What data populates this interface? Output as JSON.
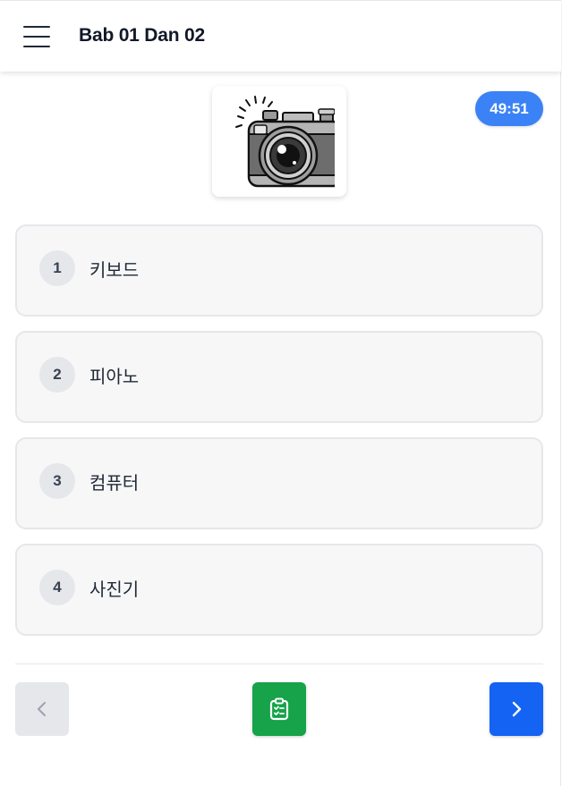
{
  "header": {
    "title": "Bab 01 Dan 02",
    "menu_icon": "hamburger-menu-icon"
  },
  "question": {
    "image": "camera-illustration",
    "timer": "49:51"
  },
  "options": [
    {
      "number": "1",
      "label": "키보드"
    },
    {
      "number": "2",
      "label": "피아노"
    },
    {
      "number": "3",
      "label": "컴퓨터"
    },
    {
      "number": "4",
      "label": "사진기"
    }
  ],
  "footer": {
    "prev_icon": "chevron-left-icon",
    "clipboard_icon": "clipboard-check-icon",
    "next_icon": "chevron-right-icon"
  },
  "colors": {
    "timer_bg": "#3b82f6",
    "clipboard_bg": "#16a34a",
    "next_bg": "#1463f3",
    "prev_bg": "#e5e7eb"
  }
}
